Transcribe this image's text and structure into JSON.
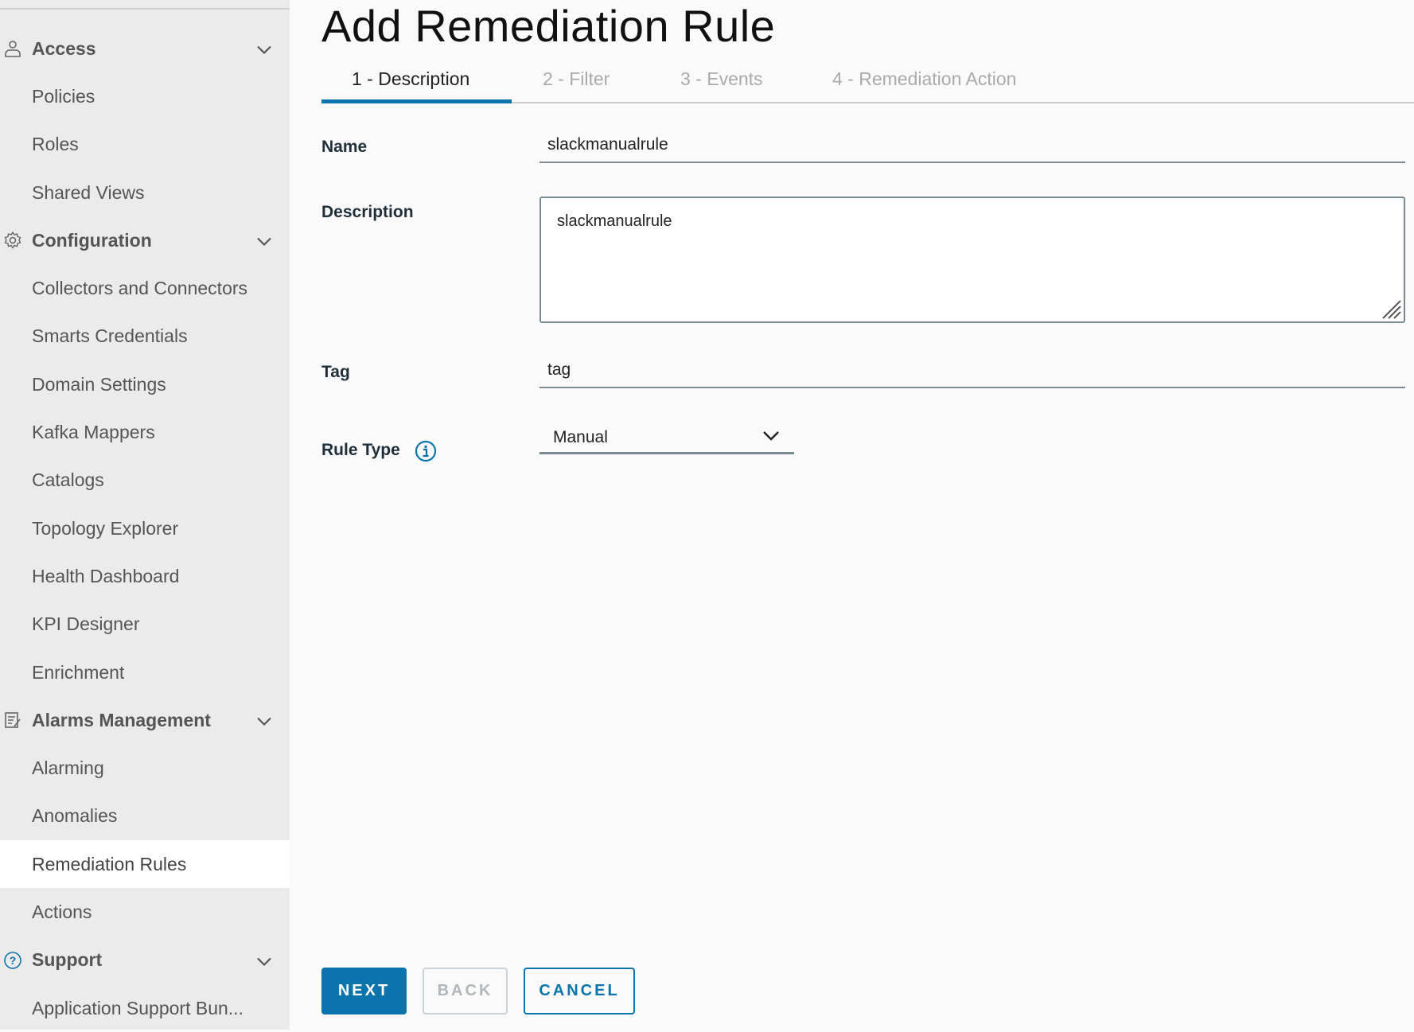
{
  "sidebar": {
    "items": [
      {
        "label": "Access",
        "type": "section",
        "icon": "user-icon"
      },
      {
        "label": "Policies"
      },
      {
        "label": "Roles"
      },
      {
        "label": "Shared Views"
      },
      {
        "label": "Configuration",
        "type": "section",
        "icon": "gear-icon"
      },
      {
        "label": "Collectors and Connectors"
      },
      {
        "label": "Smarts Credentials"
      },
      {
        "label": "Domain Settings"
      },
      {
        "label": "Kafka Mappers"
      },
      {
        "label": "Catalogs"
      },
      {
        "label": "Topology Explorer"
      },
      {
        "label": "Health Dashboard"
      },
      {
        "label": "KPI Designer"
      },
      {
        "label": "Enrichment"
      },
      {
        "label": "Alarms Management",
        "type": "section",
        "icon": "clipboard-icon"
      },
      {
        "label": "Alarming"
      },
      {
        "label": "Anomalies"
      },
      {
        "label": "Remediation Rules",
        "active": true
      },
      {
        "label": "Actions"
      },
      {
        "label": "Support",
        "type": "section",
        "icon": "help-icon"
      },
      {
        "label": "Application Support Bun..."
      }
    ]
  },
  "main": {
    "title": "Add Remediation Rule",
    "tabs": [
      {
        "label": "1 - Description",
        "active": true
      },
      {
        "label": "2 - Filter"
      },
      {
        "label": "3 - Events"
      },
      {
        "label": "4 - Remediation Action"
      }
    ],
    "form": {
      "name_label": "Name",
      "name_value": "slackmanualrule",
      "description_label": "Description",
      "description_value": "slackmanualrule",
      "tag_label": "Tag",
      "tag_value": "tag",
      "rule_type_label": "Rule Type",
      "rule_type_value": "Manual"
    },
    "buttons": {
      "next": "NEXT",
      "back": "BACK",
      "cancel": "CANCEL"
    }
  },
  "colors": {
    "accent": "#0b74ad",
    "sidebar_bg": "#ebebeb"
  }
}
